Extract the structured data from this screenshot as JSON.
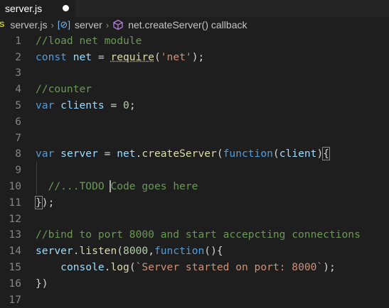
{
  "tab": {
    "label": "server.js"
  },
  "breadcrumb": {
    "file_badge": "JS",
    "file": "server.js",
    "symbol_icon": "[⊘]",
    "symbol": "server",
    "method": "net.createServer() callback"
  },
  "lines": [
    {
      "n": "1"
    },
    {
      "n": "2"
    },
    {
      "n": "3"
    },
    {
      "n": "4"
    },
    {
      "n": "5"
    },
    {
      "n": "6"
    },
    {
      "n": "7"
    },
    {
      "n": "8"
    },
    {
      "n": "9"
    },
    {
      "n": "10"
    },
    {
      "n": "11"
    },
    {
      "n": "12"
    },
    {
      "n": "13"
    },
    {
      "n": "14"
    },
    {
      "n": "15"
    },
    {
      "n": "16"
    },
    {
      "n": "17"
    }
  ],
  "code": {
    "l1": "//load net module",
    "l2_kw": "const",
    "l2_id": "net",
    "l2_eq": " = ",
    "l2_fn": "require",
    "l2_str": "'net'",
    "l4": "//counter",
    "l5_kw": "var",
    "l5_id": "clients",
    "l5_eq": " = ",
    "l5_num": "0",
    "l8_kw": "var",
    "l8_id": "server",
    "l8_net": "net",
    "l8_fn": "createServer",
    "l8_kw2": "function",
    "l8_arg": "client",
    "l10_a": "//...TODO ",
    "l10_b": "Code goes here",
    "l13": "//bind to port 8000 and start accepcting connections",
    "l14_id": "server",
    "l14_fn": "listen",
    "l14_num": "8000",
    "l14_kw": "function",
    "l15_id": "console",
    "l15_fn": "log",
    "l15_str": "`Server started on port: 8000`"
  }
}
